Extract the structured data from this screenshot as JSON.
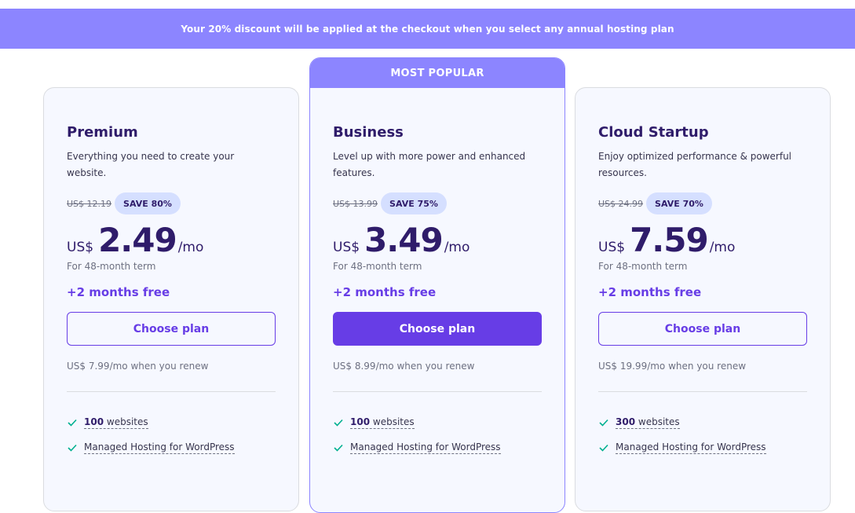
{
  "banner": {
    "text": "Your 20% discount will be applied at the checkout when you select any annual hosting plan"
  },
  "colors": {
    "accent": "#673de6",
    "banner": "#8c85ff",
    "badge": "#d5dfff",
    "check": "#00b090"
  },
  "plans": [
    {
      "name": "Premium",
      "description": "Everything you need to create your website.",
      "old_price": "US$ 12.19",
      "save": "SAVE 80%",
      "currency": "US$",
      "amount": "2.49",
      "period": "/mo",
      "term": "For 48-month term",
      "bonus": "+2 months free",
      "cta": "Choose plan",
      "renew": "US$ 7.99/mo when you renew",
      "features": [
        {
          "count": "100",
          "text": " websites"
        },
        {
          "count": "",
          "text": "Managed Hosting for WordPress"
        }
      ]
    },
    {
      "name": "Business",
      "badge": "MOST POPULAR",
      "description": "Level up with more power and enhanced features.",
      "old_price": "US$ 13.99",
      "save": "SAVE 75%",
      "currency": "US$",
      "amount": "3.49",
      "period": "/mo",
      "term": "For 48-month term",
      "bonus": "+2 months free",
      "cta": "Choose plan",
      "renew": "US$ 8.99/mo when you renew",
      "features": [
        {
          "count": "100",
          "text": " websites"
        },
        {
          "count": "",
          "text": "Managed Hosting for WordPress"
        }
      ]
    },
    {
      "name": "Cloud Startup",
      "description": "Enjoy optimized performance & powerful resources.",
      "old_price": "US$ 24.99",
      "save": "SAVE 70%",
      "currency": "US$",
      "amount": "7.59",
      "period": "/mo",
      "term": "For 48-month term",
      "bonus": "+2 months free",
      "cta": "Choose plan",
      "renew": "US$ 19.99/mo when you renew",
      "features": [
        {
          "count": "300",
          "text": " websites"
        },
        {
          "count": "",
          "text": "Managed Hosting for WordPress"
        }
      ]
    }
  ]
}
